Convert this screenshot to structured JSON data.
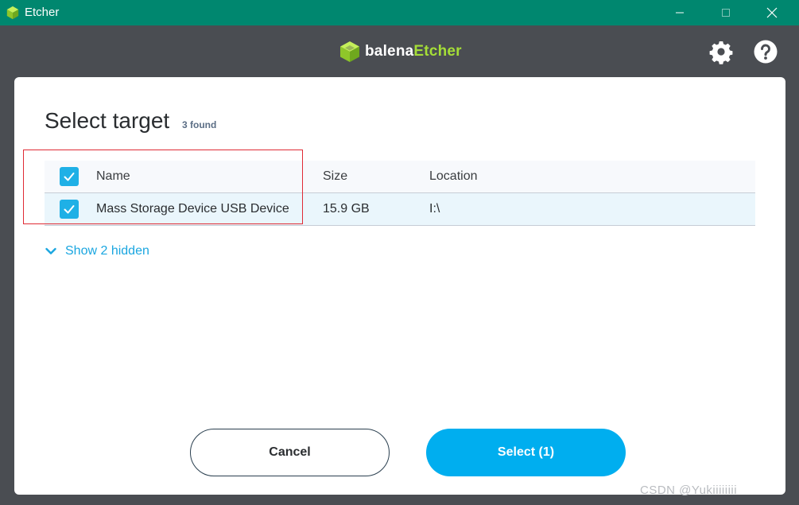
{
  "window": {
    "title": "Etcher",
    "icon": "etcher-cube-icon"
  },
  "header": {
    "brand_part1": "balena",
    "brand_part2": "Etcher",
    "brand_color": "#a5de37",
    "settings_icon": "gear-icon",
    "help_icon": "help-icon"
  },
  "modal": {
    "title": "Select target",
    "found_count": "3 found",
    "table": {
      "columns": [
        "Name",
        "Size",
        "Location"
      ],
      "rows": [
        {
          "checked": true,
          "name": "Mass Storage Device USB Device",
          "size": "15.9 GB",
          "location": "I:\\"
        }
      ]
    },
    "show_hidden": "Show 2 hidden",
    "cancel_label": "Cancel",
    "select_label": "Select (1)"
  },
  "colors": {
    "titlebar": "#00876f",
    "header": "#4a4d52",
    "accent": "#00aeef",
    "checkbox": "#1fb0e6",
    "highlight": "#e02b35"
  },
  "watermark": "CSDN @Yukiiiiiiii"
}
